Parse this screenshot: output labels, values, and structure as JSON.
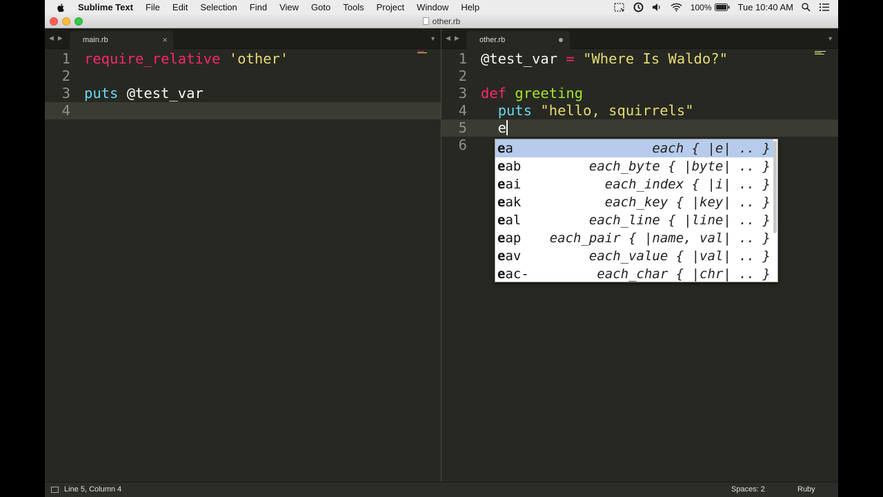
{
  "menubar": {
    "app_name": "Sublime Text",
    "items": [
      "File",
      "Edit",
      "Selection",
      "Find",
      "View",
      "Goto",
      "Tools",
      "Project",
      "Window",
      "Help"
    ],
    "battery": "100%",
    "clock": "Tue 10:40 AM"
  },
  "window": {
    "title": "other.rb"
  },
  "left_pane": {
    "tab_label": "main.rb",
    "tab_close": "×",
    "lines": [
      {
        "num": "1",
        "parts": [
          {
            "t": "require_relative",
            "c": "red"
          },
          {
            "t": " ",
            "c": "white"
          },
          {
            "t": "'other'",
            "c": "yellow"
          }
        ]
      },
      {
        "num": "2",
        "parts": []
      },
      {
        "num": "3",
        "parts": [
          {
            "t": "puts",
            "c": "cyan"
          },
          {
            "t": " @test_var",
            "c": "white"
          }
        ]
      },
      {
        "num": "4",
        "parts": [],
        "active": true
      }
    ]
  },
  "right_pane": {
    "tab_label": "other.rb",
    "lines": [
      {
        "num": "1",
        "parts": [
          {
            "t": "@test_var ",
            "c": "white"
          },
          {
            "t": "=",
            "c": "red"
          },
          {
            "t": " ",
            "c": "white"
          },
          {
            "t": "\"Where Is Waldo?\"",
            "c": "yellow"
          }
        ]
      },
      {
        "num": "2",
        "parts": []
      },
      {
        "num": "3",
        "parts": [
          {
            "t": "def",
            "c": "red"
          },
          {
            "t": " ",
            "c": "white"
          },
          {
            "t": "greeting",
            "c": "green"
          }
        ]
      },
      {
        "num": "4",
        "parts": [
          {
            "t": "  ",
            "c": "white"
          },
          {
            "t": "puts",
            "c": "cyan"
          },
          {
            "t": " ",
            "c": "white"
          },
          {
            "t": "\"hello, squirrels\"",
            "c": "yellow"
          }
        ]
      },
      {
        "num": "5",
        "parts": [
          {
            "t": "  e",
            "c": "white"
          }
        ],
        "active": true,
        "caret": true
      },
      {
        "num": "6",
        "parts": []
      }
    ]
  },
  "autocomplete": {
    "items": [
      {
        "bold": "e",
        "rest": "a",
        "hint": "each { |e| .. }",
        "selected": true
      },
      {
        "bold": "e",
        "rest": "ab",
        "hint": "each_byte { |byte| .. }"
      },
      {
        "bold": "e",
        "rest": "ai",
        "hint": "each_index { |i| .. }"
      },
      {
        "bold": "e",
        "rest": "ak",
        "hint": "each_key { |key| .. }"
      },
      {
        "bold": "e",
        "rest": "al",
        "hint": "each_line { |line| .. }"
      },
      {
        "bold": "e",
        "rest": "ap",
        "hint": "each_pair { |name, val| .. }"
      },
      {
        "bold": "e",
        "rest": "av",
        "hint": "each_value { |val| .. }"
      },
      {
        "bold": "e",
        "rest": "ac-",
        "hint": "each_char { |chr| .. }"
      }
    ]
  },
  "statusbar": {
    "position": "Line 5, Column 4",
    "spaces": "Spaces: 2",
    "syntax": "Ruby"
  },
  "colors": {
    "background": "#272822",
    "keyword": "#f92672",
    "string": "#e6db74",
    "builtin": "#66d9ef",
    "function": "#a6e22e",
    "selection": "#b7cbec"
  }
}
